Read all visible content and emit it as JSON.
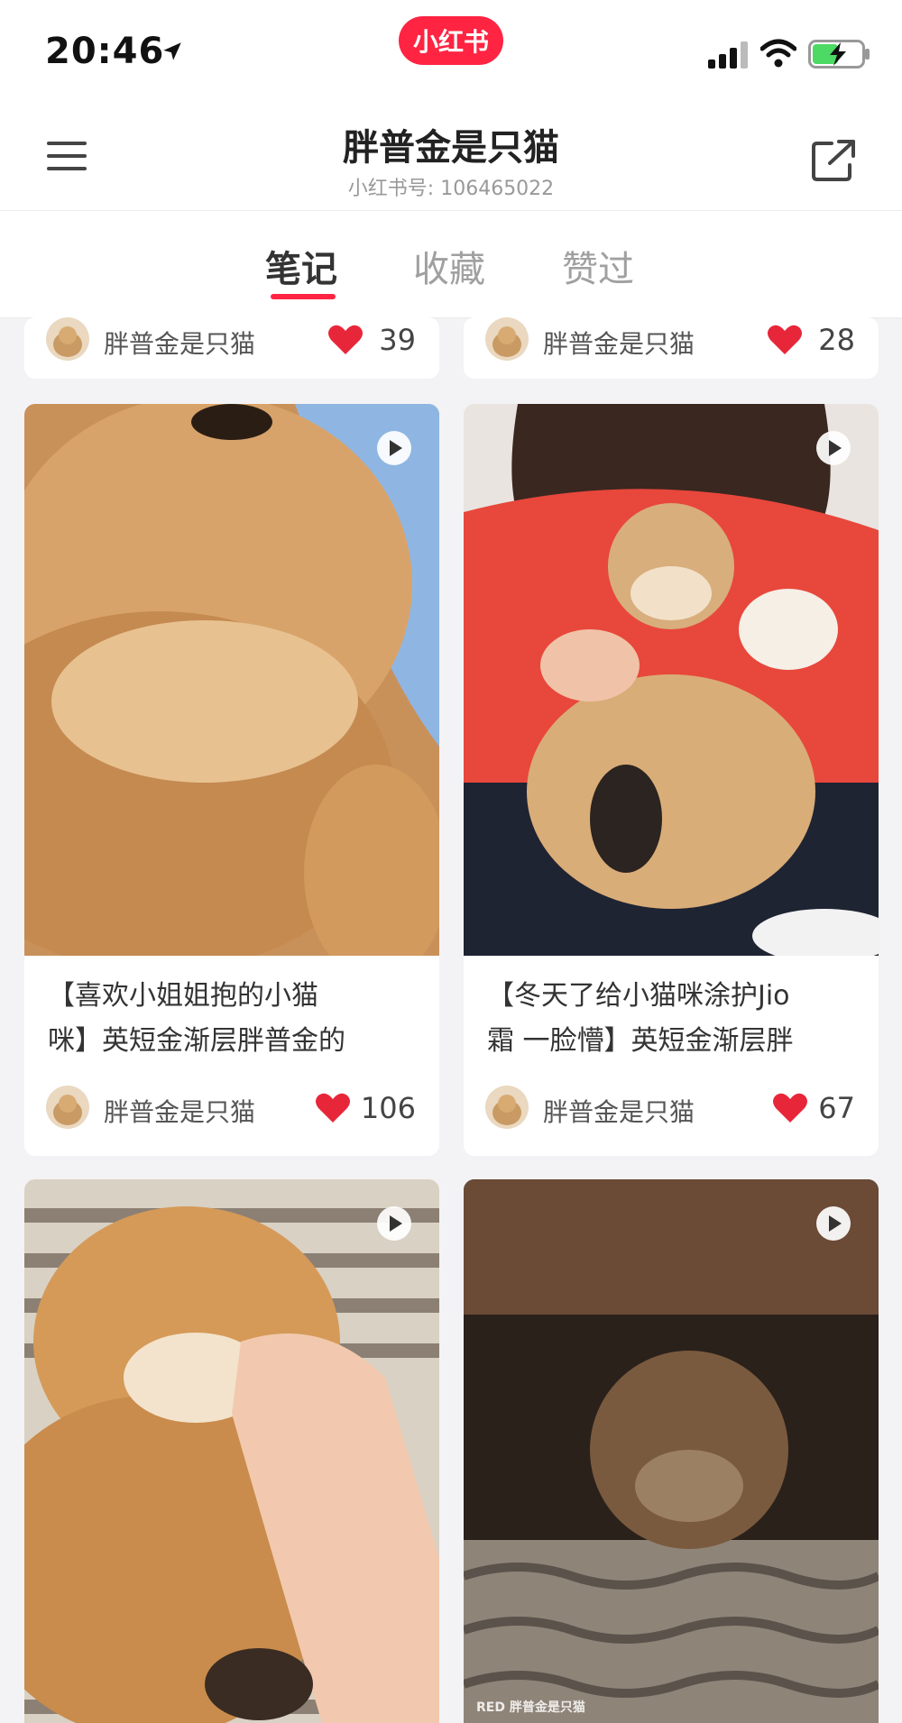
{
  "status": {
    "time": "20:46"
  },
  "app": {
    "logo_text": "小红书"
  },
  "profile": {
    "name": "胖普金是只猫",
    "id_label": "小红书号: 106465022"
  },
  "tabs": [
    {
      "label": "笔记",
      "active": true
    },
    {
      "label": "收藏",
      "active": false
    },
    {
      "label": "赞过",
      "active": false
    }
  ],
  "notes": [
    {
      "author": "胖普金是只猫",
      "likes": "39"
    },
    {
      "author": "胖普金是只猫",
      "likes": "28"
    },
    {
      "title_line1": "【喜欢小姐姐抱的小猫",
      "title_line2": "咪】英短金渐层胖普金的",
      "author": "胖普金是只猫",
      "likes": "106",
      "video": true
    },
    {
      "title_line1": "【冬天了给小猫咪涂护Jio",
      "title_line2": "霜 一脸懵】英短金渐层胖",
      "author": "胖普金是只猫",
      "likes": "67",
      "video": true
    },
    {
      "video": true,
      "watermark": ""
    },
    {
      "video": true,
      "watermark": "RED 胖普金是只猫"
    }
  ],
  "colors": {
    "accent": "#ff2442",
    "heart": "#e8263a"
  }
}
